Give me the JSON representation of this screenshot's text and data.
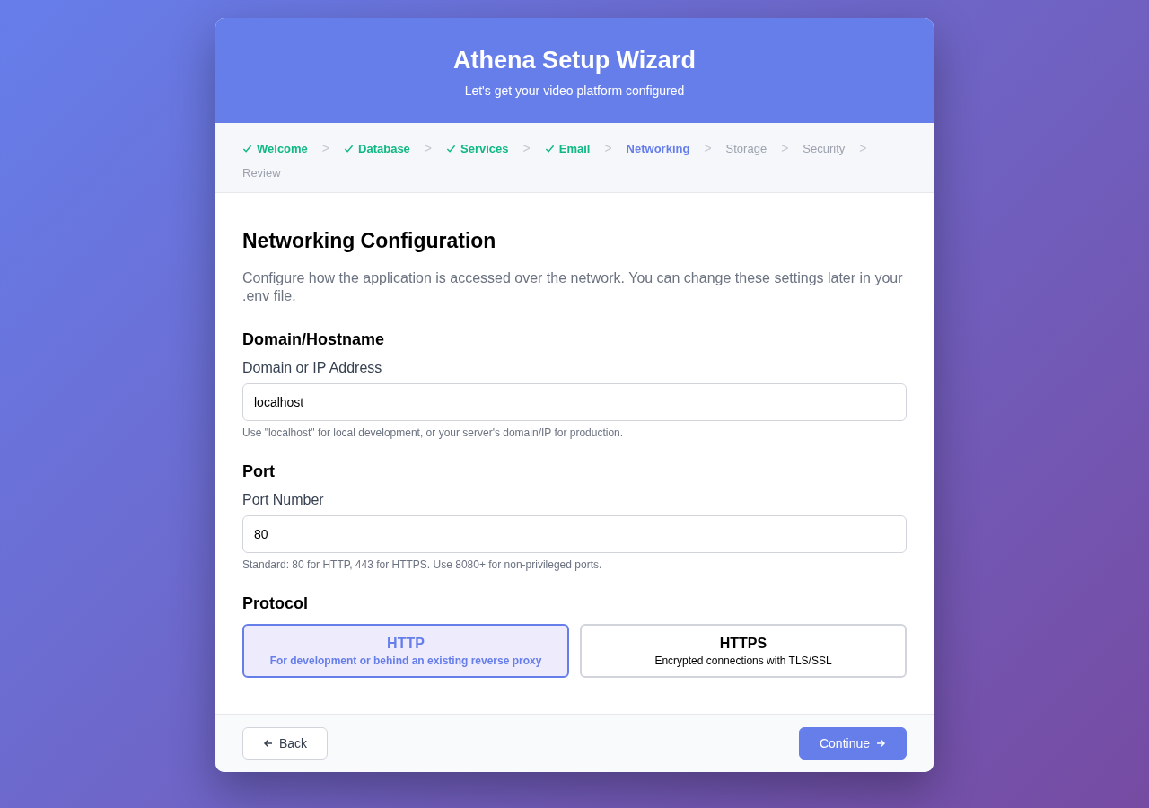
{
  "header": {
    "title": "Athena Setup Wizard",
    "subtitle": "Let's get your video platform configured"
  },
  "steps": [
    {
      "label": "Welcome",
      "completed": true,
      "selected": false
    },
    {
      "label": "Database",
      "completed": true,
      "selected": false,
      "separator": ">"
    },
    {
      "label": "Services",
      "completed": true,
      "selected": false,
      "separator": ">"
    },
    {
      "label": "Email",
      "completed": true,
      "selected": false,
      "separator": ">"
    },
    {
      "label": "Networking",
      "completed": false,
      "selected": true,
      "separator": ">"
    },
    {
      "label": "Storage",
      "completed": false,
      "selected": false,
      "separator": ">"
    },
    {
      "label": "Security",
      "completed": false,
      "selected": false,
      "separator": ">"
    },
    {
      "label": "Review",
      "completed": false,
      "selected": false,
      "separator": ">"
    }
  ],
  "content": {
    "title": "Networking Configuration",
    "description": "Configure how the application is accessed over the network. You can change these settings later in your .env file.",
    "sections": [
      {
        "heading": "Domain/Hostname",
        "field_label": "Domain or IP Address",
        "value": "localhost",
        "help": "Use \"localhost\" for local development, or your server's domain/IP for production."
      },
      {
        "heading": "Port",
        "field_label": "Port Number",
        "value": "80",
        "help": "Standard: 80 for HTTP, 443 for HTTPS. Use 8080+ for non-privileged ports."
      }
    ],
    "protocol": {
      "heading": "Protocol",
      "options": [
        {
          "title": "HTTP",
          "description": "For development or behind an existing reverse proxy",
          "selected": true
        },
        {
          "title": "HTTPS",
          "description": "Encrypted connections with TLS/SSL",
          "selected": false
        }
      ]
    }
  },
  "footer": {
    "back": "Back",
    "continue": "Continue"
  }
}
